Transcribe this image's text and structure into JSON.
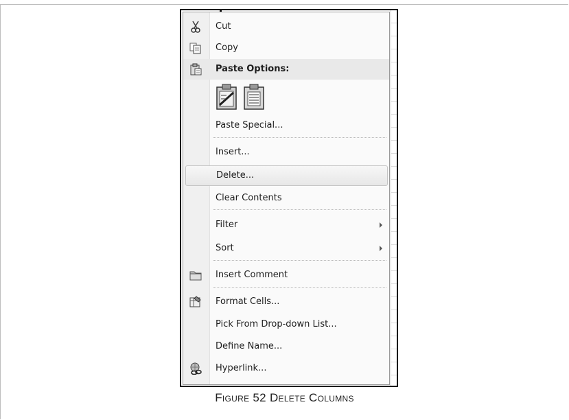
{
  "menu": {
    "cut": "Cut",
    "copy": "Copy",
    "paste_options": "Paste Options:",
    "paste_special": "Paste Special...",
    "insert": "Insert...",
    "delete": "Delete...",
    "clear_contents": "Clear Contents",
    "filter": "Filter",
    "sort": "Sort",
    "insert_comment": "Insert Comment",
    "format_cells": "Format Cells...",
    "pick_list": "Pick From Drop-down List...",
    "define_name": "Define Name...",
    "hyperlink": "Hyperlink..."
  },
  "icons": {
    "cut": "scissors-icon",
    "copy": "copy-icon",
    "paste": "paste-icon",
    "paste_all": "paste-all-icon",
    "paste_values": "paste-values-icon",
    "comment": "comment-icon",
    "format": "format-cells-icon",
    "hyperlink": "hyperlink-icon",
    "submenu": "submenu-arrow-icon"
  },
  "caption": "Figure 52 Delete Columns"
}
